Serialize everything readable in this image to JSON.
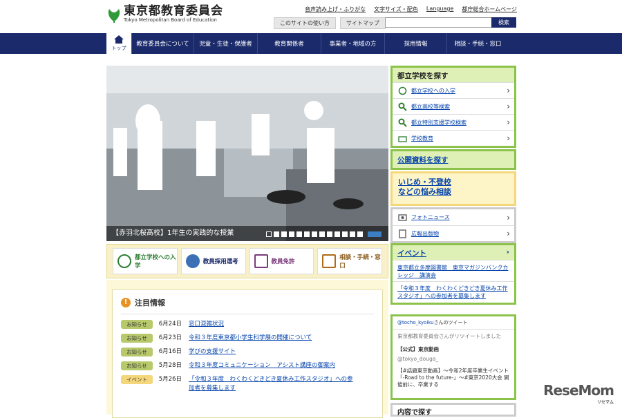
{
  "header": {
    "logo_title": "東京都教育委員会",
    "logo_sub": "Tokyo Metropolitan Board of Education",
    "toplinks": [
      "音声読み上げ・ふりがな",
      "文字サイズ・配色",
      "Language",
      "都庁総合ホームページ"
    ],
    "subbtns": [
      "このサイトの使い方",
      "サイトマップ"
    ],
    "search_button": "検索"
  },
  "nav": {
    "home": "トップ",
    "items": [
      "教育委員会について",
      "児童・生徒・保護者",
      "教育関係者",
      "事業者・地域の方",
      "採用情報",
      "相談・手続・窓口"
    ]
  },
  "hero": {
    "caption": "【赤羽北桜高校】1年生の実践的な授業",
    "slide_count": 13
  },
  "quick": [
    "都立学校への入学",
    "教員採用選考",
    "教員免許",
    "相談・手続・窓口"
  ],
  "news": {
    "title": "注目情報",
    "rows": [
      {
        "tag": "お知らせ",
        "date": "6月24日",
        "text": "窓口混雑状況"
      },
      {
        "tag": "お知らせ",
        "date": "6月23日",
        "text": "令和３年度東京都小学生科学展の開催について"
      },
      {
        "tag": "お知らせ",
        "date": "6月16日",
        "text": "学びの支援サイト"
      },
      {
        "tag": "お知らせ",
        "date": "5月28日",
        "text": "令和３年度コミュニケーション　アシスト講座の御案内"
      },
      {
        "tag": "イベント",
        "date": "5月26日",
        "text": "「令和３年度　わくわくどきどき夏休み工作スタジオ」への参加者を募集します"
      }
    ]
  },
  "side": {
    "schools": {
      "title": "都立学校を探す",
      "items": [
        "都立学校への入学",
        "都立高校等検索",
        "都立特別支援学校検索",
        "学校教育"
      ]
    },
    "docs": "公開資料を探す",
    "bullying": "いじめ・不登校などの悩み相談",
    "photo": [
      "フォトニュース",
      "広報出版物"
    ],
    "event": {
      "title": "イベント",
      "items": [
        "東京都立多摩図書館　東京マガジンバンクカレッジ　講演会",
        "「令和３年度　わくわくどきどき夏休み工作スタジオ」への参加者を募集します"
      ]
    },
    "tweet": {
      "handle": "@tocho_kyoiku",
      "suffix": "さんのツイート",
      "retweet": "東京都教育委員会さんがリツイートしました",
      "name": "【公式】東京動画",
      "id": "@tokyo_douga_",
      "body": "【#話題東京動画】～令和2年度卒業生イベント「-Road to the future-」～#東京2020大会 開催前に、卒業する"
    },
    "content_search": "内容で探す"
  },
  "watermark": {
    "brand": "ReseMom",
    "sub": "リセマム"
  },
  "colors": {
    "nav": "#1a2a6b",
    "green": "#8bc34a",
    "yellow": "#f5d77b"
  }
}
